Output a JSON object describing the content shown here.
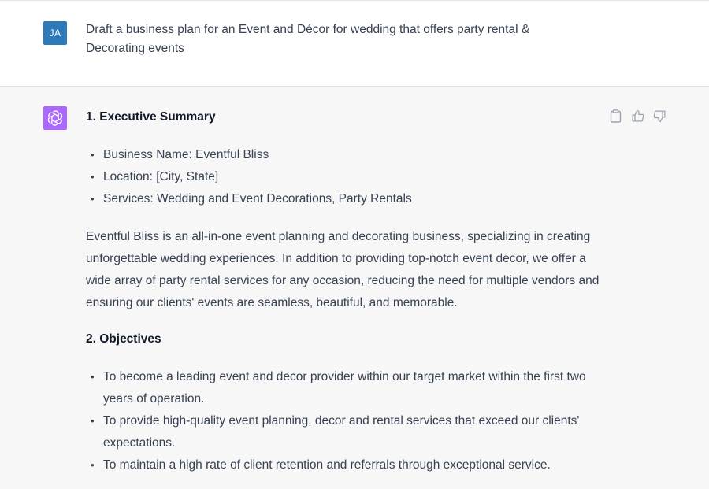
{
  "user_message": {
    "avatar_initials": "JA",
    "text": "Draft a business plan for an Event and Décor for wedding that offers party rental & Decorating events"
  },
  "assistant_message": {
    "avatar_icon": "openai-logo-icon",
    "actions": {
      "copy_icon": "clipboard-icon",
      "like_icon": "thumbs-up-icon",
      "dislike_icon": "thumbs-down-icon"
    },
    "section1": {
      "heading": "1. Executive Summary",
      "bullets": [
        "Business Name: Eventful Bliss",
        "Location: [City, State]",
        "Services: Wedding and Event Decorations, Party Rentals"
      ],
      "paragraph": "Eventful Bliss is an all-in-one event planning and decorating business, specializing in creating unforgettable wedding experiences. In addition to providing top-notch event decor, we offer a wide array of party rental services for any occasion, reducing the need for multiple vendors and ensuring our clients' events are seamless, beautiful, and memorable."
    },
    "section2": {
      "heading": "2. Objectives",
      "bullets": [
        "To become a leading event and decor provider within our target market within the first two years of operation.",
        "To provide high-quality event planning, decor and rental services that exceed our clients' expectations.",
        "To maintain a high rate of client retention and referrals through exceptional service."
      ]
    }
  },
  "colors": {
    "user_avatar": "#2e7ab8",
    "assistant_avatar": "#ab68ff",
    "assistant_bg": "#f7f7f8"
  }
}
